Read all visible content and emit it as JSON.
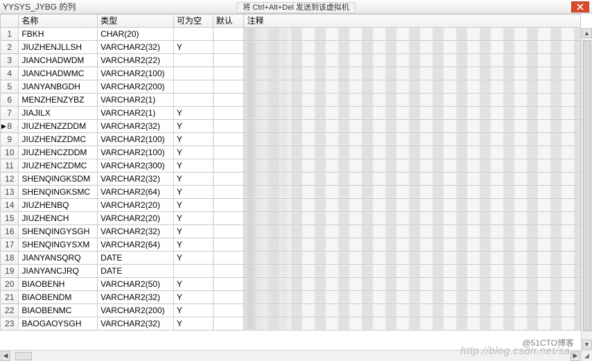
{
  "titlebar": {
    "left_text": "YYSYS_JYBG 的列",
    "center_button": "将 Ctrl+Alt+Del 发送到该虚拟机"
  },
  "columns": {
    "name": "名称",
    "type": "类型",
    "nullable": "可为空",
    "default": "默认",
    "comment": "注释"
  },
  "rows": [
    {
      "n": "1",
      "name": "FBKH",
      "type": "CHAR(20)",
      "nullable": "",
      "default": "",
      "comment": ""
    },
    {
      "n": "2",
      "name": "JIUZHENJLLSH",
      "type": "VARCHAR2(32)",
      "nullable": "Y",
      "default": "",
      "comment": ""
    },
    {
      "n": "3",
      "name": "JIANCHADWDM",
      "type": "VARCHAR2(22)",
      "nullable": "",
      "default": "",
      "comment": ""
    },
    {
      "n": "4",
      "name": "JIANCHADWMC",
      "type": "VARCHAR2(100)",
      "nullable": "",
      "default": "",
      "comment": ""
    },
    {
      "n": "5",
      "name": "JIANYANBGDH",
      "type": "VARCHAR2(200)",
      "nullable": "",
      "default": "",
      "comment": ""
    },
    {
      "n": "6",
      "name": "MENZHENZYBZ",
      "type": "VARCHAR2(1)",
      "nullable": "",
      "default": "",
      "comment": ""
    },
    {
      "n": "7",
      "name": "JIAJILX",
      "type": "VARCHAR2(1)",
      "nullable": "Y",
      "default": "",
      "comment": ""
    },
    {
      "n": "8",
      "name": "JIUZHENZZDDM",
      "type": "VARCHAR2(32)",
      "nullable": "Y",
      "default": "",
      "comment": "",
      "selected": true
    },
    {
      "n": "9",
      "name": "JIUZHENZZDMC",
      "type": "VARCHAR2(100)",
      "nullable": "Y",
      "default": "",
      "comment": ""
    },
    {
      "n": "10",
      "name": "JIUZHENCZDDM",
      "type": "VARCHAR2(100)",
      "nullable": "Y",
      "default": "",
      "comment": ""
    },
    {
      "n": "11",
      "name": "JIUZHENCZDMC",
      "type": "VARCHAR2(300)",
      "nullable": "Y",
      "default": "",
      "comment": ""
    },
    {
      "n": "12",
      "name": "SHENQINGKSDM",
      "type": "VARCHAR2(32)",
      "nullable": "Y",
      "default": "",
      "comment": ""
    },
    {
      "n": "13",
      "name": "SHENQINGKSMC",
      "type": "VARCHAR2(64)",
      "nullable": "Y",
      "default": "",
      "comment": ""
    },
    {
      "n": "14",
      "name": "JIUZHENBQ",
      "type": "VARCHAR2(20)",
      "nullable": "Y",
      "default": "",
      "comment": ""
    },
    {
      "n": "15",
      "name": "JIUZHENCH",
      "type": "VARCHAR2(20)",
      "nullable": "Y",
      "default": "",
      "comment": ""
    },
    {
      "n": "16",
      "name": "SHENQINGYSGH",
      "type": "VARCHAR2(32)",
      "nullable": "Y",
      "default": "",
      "comment": ""
    },
    {
      "n": "17",
      "name": "SHENQINGYSXM",
      "type": "VARCHAR2(64)",
      "nullable": "Y",
      "default": "",
      "comment": ""
    },
    {
      "n": "18",
      "name": "JIANYANSQRQ",
      "type": "DATE",
      "nullable": "Y",
      "default": "",
      "comment": ""
    },
    {
      "n": "19",
      "name": "JIANYANCJRQ",
      "type": "DATE",
      "nullable": "",
      "default": "",
      "comment": ""
    },
    {
      "n": "20",
      "name": "BIAOBENH",
      "type": "VARCHAR2(50)",
      "nullable": "Y",
      "default": "",
      "comment": ""
    },
    {
      "n": "21",
      "name": "BIAOBENDM",
      "type": "VARCHAR2(32)",
      "nullable": "Y",
      "default": "",
      "comment": ""
    },
    {
      "n": "22",
      "name": "BIAOBENMC",
      "type": "VARCHAR2(200)",
      "nullable": "Y",
      "default": "",
      "comment": ""
    },
    {
      "n": "23",
      "name": "BAOGAOYSGH",
      "type": "VARCHAR2(32)",
      "nullable": "Y",
      "default": "",
      "comment": ""
    }
  ],
  "watermark": {
    "faint": "http://blog.csdn.net/sa…",
    "badge": "@51CTO博客"
  }
}
